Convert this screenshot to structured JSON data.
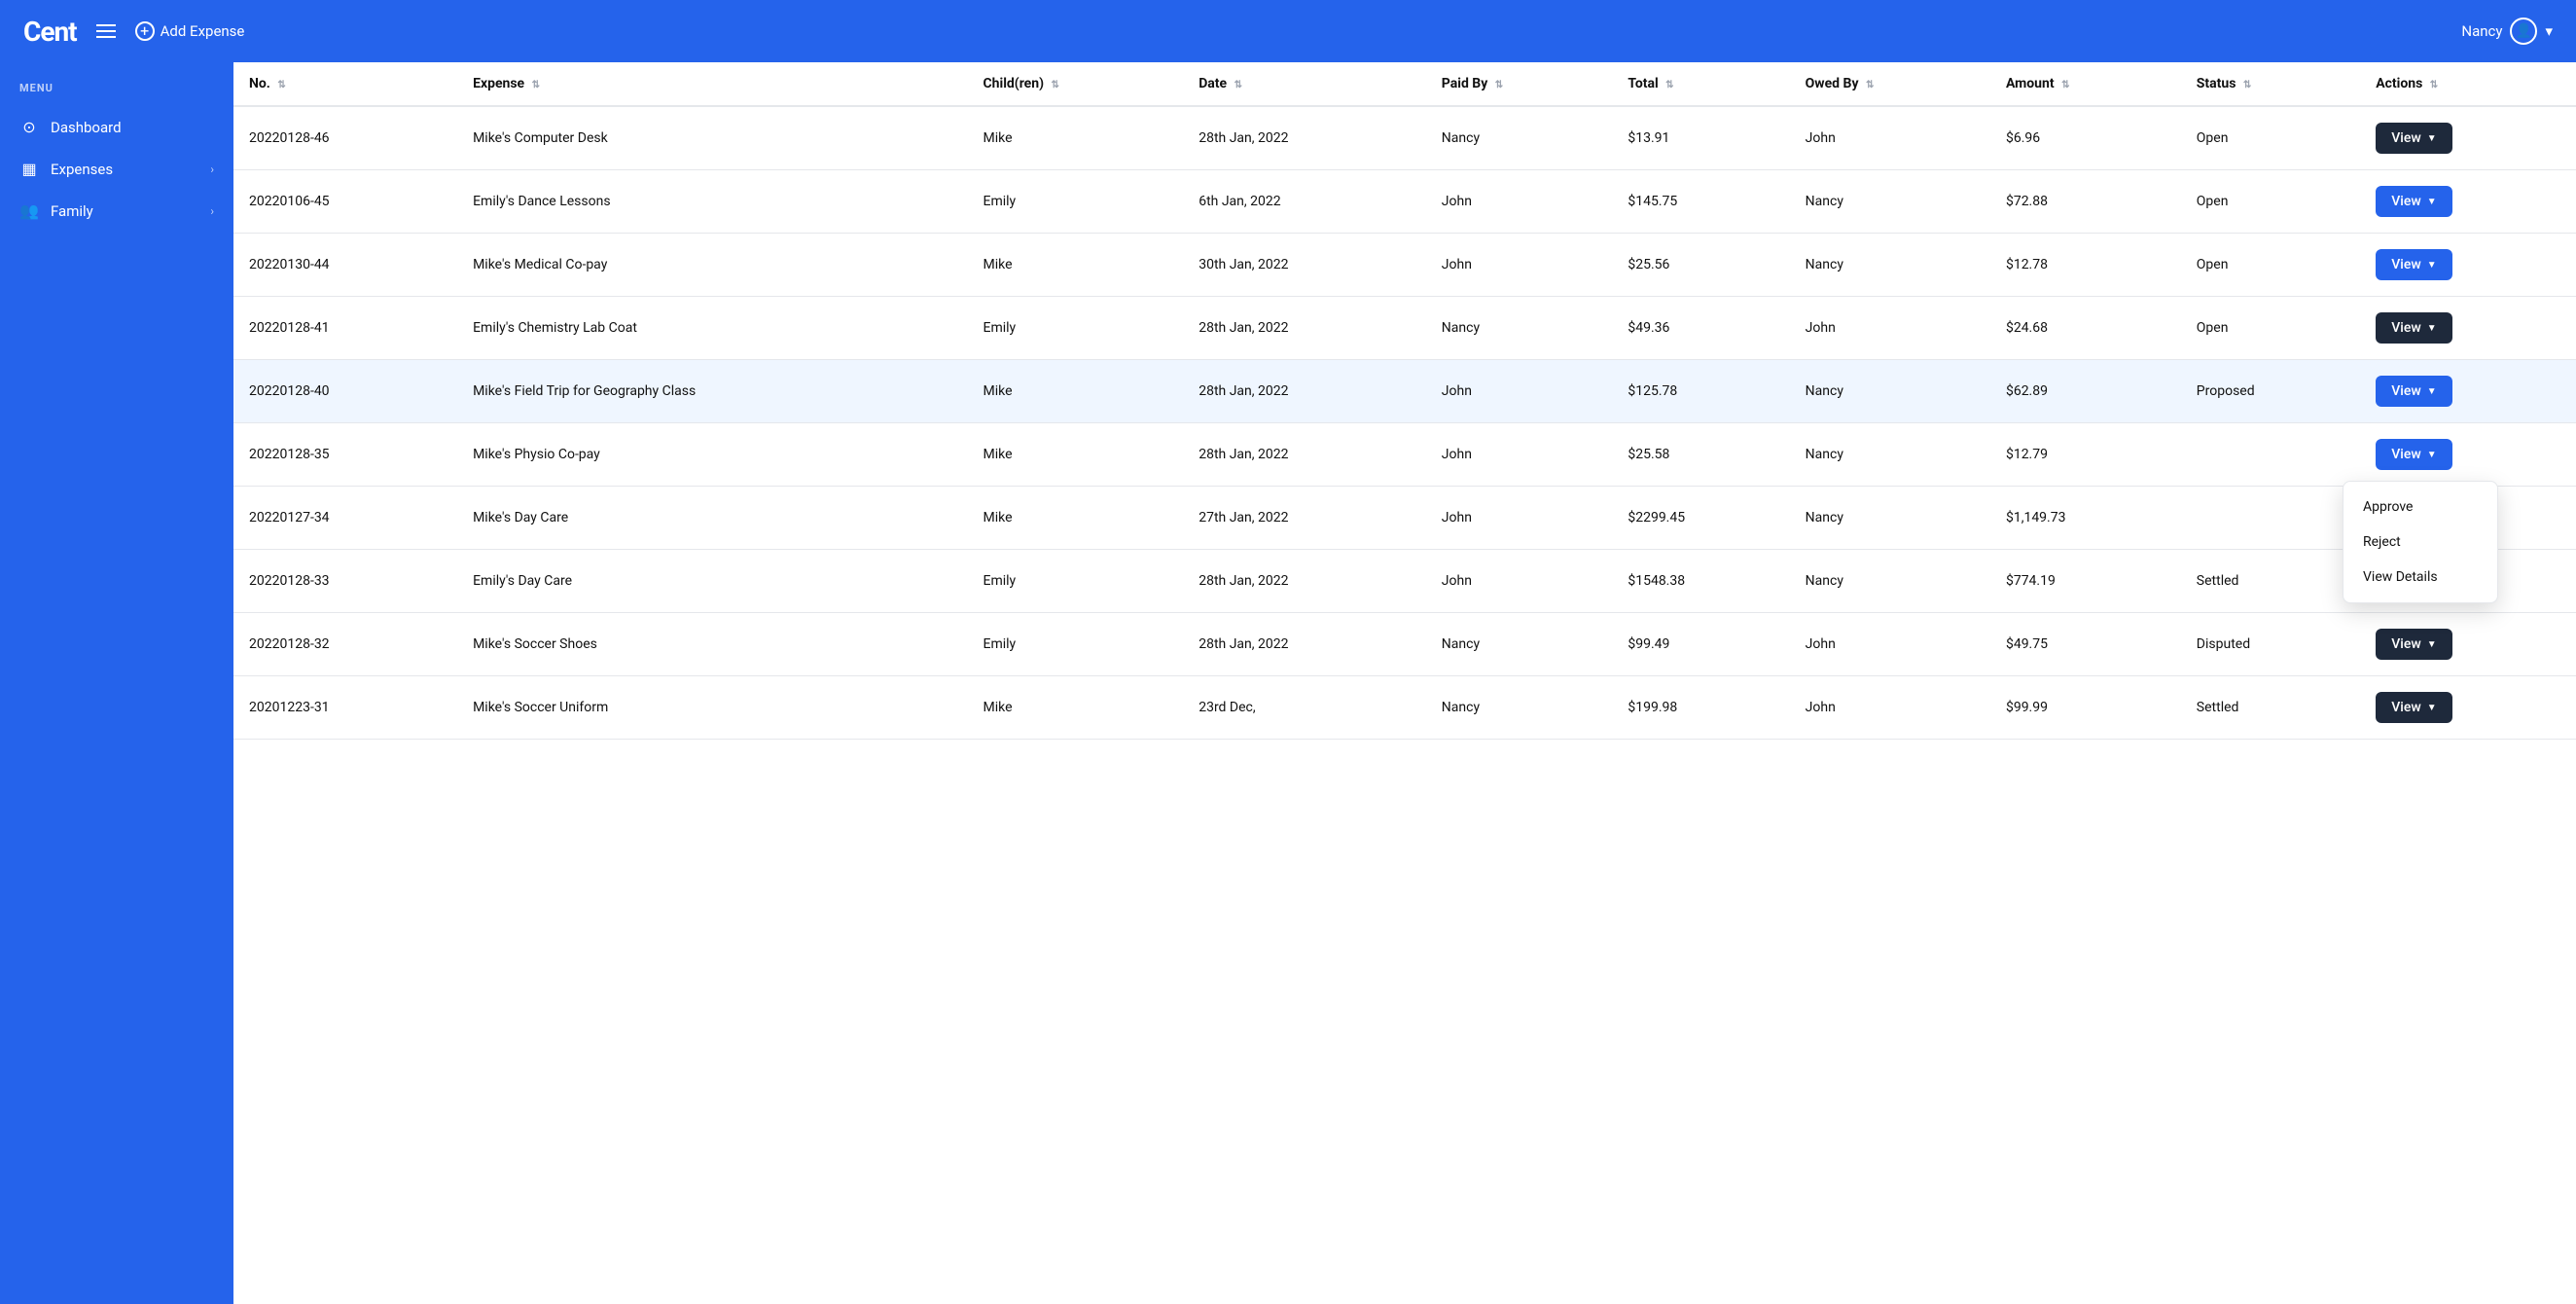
{
  "app": {
    "logo": "Cent",
    "add_expense_label": "Add Expense",
    "user_name": "Nancy"
  },
  "sidebar": {
    "menu_label": "MENU",
    "items": [
      {
        "id": "dashboard",
        "label": "Dashboard",
        "icon": "⊙",
        "has_chevron": false
      },
      {
        "id": "expenses",
        "label": "Expenses",
        "icon": "▦",
        "has_chevron": true
      },
      {
        "id": "family",
        "label": "Family",
        "icon": "👥",
        "has_chevron": true
      }
    ]
  },
  "table": {
    "columns": [
      {
        "id": "no",
        "label": "No."
      },
      {
        "id": "expense",
        "label": "Expense"
      },
      {
        "id": "children",
        "label": "Child(ren)"
      },
      {
        "id": "date",
        "label": "Date"
      },
      {
        "id": "paid_by",
        "label": "Paid By"
      },
      {
        "id": "total",
        "label": "Total"
      },
      {
        "id": "owed_by",
        "label": "Owed By"
      },
      {
        "id": "amount",
        "label": "Amount"
      },
      {
        "id": "status",
        "label": "Status"
      },
      {
        "id": "actions",
        "label": "Actions"
      }
    ],
    "rows": [
      {
        "no": "20220128-46",
        "expense": "Mike's Computer Desk",
        "children": "Mike",
        "date": "28th Jan, 2022",
        "paid_by": "Nancy",
        "total": "$13.91",
        "owed_by": "John",
        "amount": "$6.96",
        "status": "Open",
        "btn_dark": true
      },
      {
        "no": "20220106-45",
        "expense": "Emily's Dance Lessons",
        "children": "Emily",
        "date": "6th Jan, 2022",
        "paid_by": "John",
        "total": "$145.75",
        "owed_by": "Nancy",
        "amount": "$72.88",
        "status": "Open",
        "btn_dark": false
      },
      {
        "no": "20220130-44",
        "expense": "Mike's Medical Co-pay",
        "children": "Mike",
        "date": "30th Jan, 2022",
        "paid_by": "John",
        "total": "$25.56",
        "owed_by": "Nancy",
        "amount": "$12.78",
        "status": "Open",
        "btn_dark": false
      },
      {
        "no": "20220128-41",
        "expense": "Emily's Chemistry Lab Coat",
        "children": "Emily",
        "date": "28th Jan, 2022",
        "paid_by": "Nancy",
        "total": "$49.36",
        "owed_by": "John",
        "amount": "$24.68",
        "status": "Open",
        "btn_dark": true
      },
      {
        "no": "20220128-40",
        "expense": "Mike's Field Trip for Geography Class",
        "children": "Mike",
        "date": "28th Jan, 2022",
        "paid_by": "John",
        "total": "$125.78",
        "owed_by": "Nancy",
        "amount": "$62.89",
        "status": "Proposed",
        "btn_dark": false,
        "proposed": true
      },
      {
        "no": "20220128-35",
        "expense": "Mike's Physio Co-pay",
        "children": "Mike",
        "date": "28th Jan, 2022",
        "paid_by": "John",
        "total": "$25.58",
        "owed_by": "Nancy",
        "amount": "$12.79",
        "status": "",
        "btn_dark": false
      },
      {
        "no": "20220127-34",
        "expense": "Mike's Day Care",
        "children": "Mike",
        "date": "27th Jan, 2022",
        "paid_by": "John",
        "total": "$2299.45",
        "owed_by": "Nancy",
        "amount": "$1,149.73",
        "status": "",
        "btn_dark": false
      },
      {
        "no": "20220128-33",
        "expense": "Emily's Day Care",
        "children": "Emily",
        "date": "28th Jan, 2022",
        "paid_by": "John",
        "total": "$1548.38",
        "owed_by": "Nancy",
        "amount": "$774.19",
        "status": "Settled",
        "btn_dark": false
      },
      {
        "no": "20220128-32",
        "expense": "Mike's Soccer Shoes",
        "children": "Emily",
        "date": "28th Jan, 2022",
        "paid_by": "Nancy",
        "total": "$99.49",
        "owed_by": "John",
        "amount": "$49.75",
        "status": "Disputed",
        "btn_dark": true
      },
      {
        "no": "20201223-31",
        "expense": "Mike's Soccer Uniform",
        "children": "Mike",
        "date": "23rd Dec,",
        "paid_by": "Nancy",
        "total": "$199.98",
        "owed_by": "John",
        "amount": "$99.99",
        "status": "Settled",
        "btn_dark": true
      }
    ]
  },
  "dropdown": {
    "items": [
      "Approve",
      "Reject",
      "View Details"
    ]
  },
  "btn_label": "View",
  "btn_caret": "▼"
}
